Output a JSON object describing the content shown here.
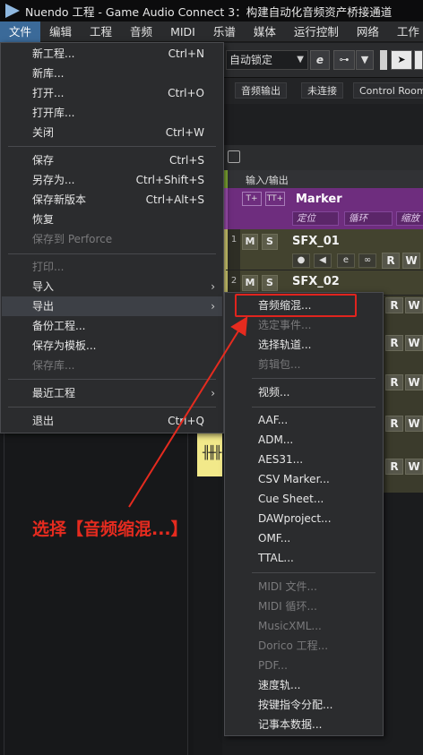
{
  "window": {
    "title": "Nuendo 工程 - Game Audio Connect 3：构建自动化音频资产桥接通道"
  },
  "menubar": {
    "items": [
      {
        "label": "文件",
        "active": true
      },
      {
        "label": "编辑"
      },
      {
        "label": "工程"
      },
      {
        "label": "音频"
      },
      {
        "label": "MIDI"
      },
      {
        "label": "乐谱"
      },
      {
        "label": "媒体"
      },
      {
        "label": "运行控制"
      },
      {
        "label": "网络"
      },
      {
        "label": "工作"
      }
    ]
  },
  "toolbar": {
    "automation_mode": "自动锁定",
    "e_button": "e",
    "strip": {
      "audio_output": "音频输出",
      "not_connected": "未连接",
      "control_room": "Control Room"
    }
  },
  "project": {
    "io_header": "输入/输出",
    "marker_track": {
      "name": "Marker",
      "locate": "定位",
      "cycle": "循环",
      "zoom": "缩放"
    },
    "tracks": [
      {
        "name": "SFX_01",
        "number": "1",
        "m": "M",
        "s": "S",
        "r": "R",
        "w": "W"
      },
      {
        "name": "SFX_02",
        "number": "2",
        "m": "M",
        "s": "S",
        "r": "R",
        "w": "W"
      }
    ]
  },
  "file_menu": {
    "items": [
      {
        "label": "新工程...",
        "shortcut": "Ctrl+N"
      },
      {
        "label": "新库..."
      },
      {
        "label": "打开...",
        "shortcut": "Ctrl+O"
      },
      {
        "label": "打开库..."
      },
      {
        "label": "关闭",
        "shortcut": "Ctrl+W"
      },
      {
        "label": "保存",
        "shortcut": "Ctrl+S"
      },
      {
        "label": "另存为...",
        "shortcut": "Ctrl+Shift+S"
      },
      {
        "label": "保存新版本",
        "shortcut": "Ctrl+Alt+S"
      },
      {
        "label": "恢复"
      },
      {
        "label": "保存到 Perforce",
        "disabled": true
      },
      {
        "label": "打印...",
        "disabled": true
      },
      {
        "label": "导入"
      },
      {
        "label": "导出",
        "highlighted": true
      },
      {
        "label": "备份工程..."
      },
      {
        "label": "保存为模板..."
      },
      {
        "label": "保存库...",
        "disabled": true
      },
      {
        "label": "最近工程"
      },
      {
        "label": "退出",
        "shortcut": "Ctrl+Q"
      }
    ]
  },
  "export_menu": {
    "items": [
      {
        "label": "音频缩混..."
      },
      {
        "label": "选定事件...",
        "disabled": true
      },
      {
        "label": "选择轨道..."
      },
      {
        "label": "剪辑包...",
        "disabled": true
      },
      {
        "label": "视频..."
      },
      {
        "label": "AAF..."
      },
      {
        "label": "ADM..."
      },
      {
        "label": "AES31..."
      },
      {
        "label": "CSV Marker..."
      },
      {
        "label": "Cue Sheet..."
      },
      {
        "label": "DAWproject..."
      },
      {
        "label": "OMF..."
      },
      {
        "label": "TTAL..."
      },
      {
        "label": "MIDI 文件...",
        "disabled": true
      },
      {
        "label": "MIDI 循环...",
        "disabled": true
      },
      {
        "label": "MusicXML...",
        "disabled": true
      },
      {
        "label": "Dorico 工程...",
        "disabled": true
      },
      {
        "label": "PDF...",
        "disabled": true
      },
      {
        "label": "速度轨..."
      },
      {
        "label": "按键指令分配..."
      },
      {
        "label": "记事本数据..."
      }
    ]
  },
  "annotation": {
    "text": "选择【音频缩混...】",
    "color": "#e52b1f"
  },
  "colors": {
    "menu_highlight": "#3d4046",
    "marker_track": "#6e2d7e",
    "audio_track": "#43432f",
    "accent_blue": "#4d86bf"
  }
}
